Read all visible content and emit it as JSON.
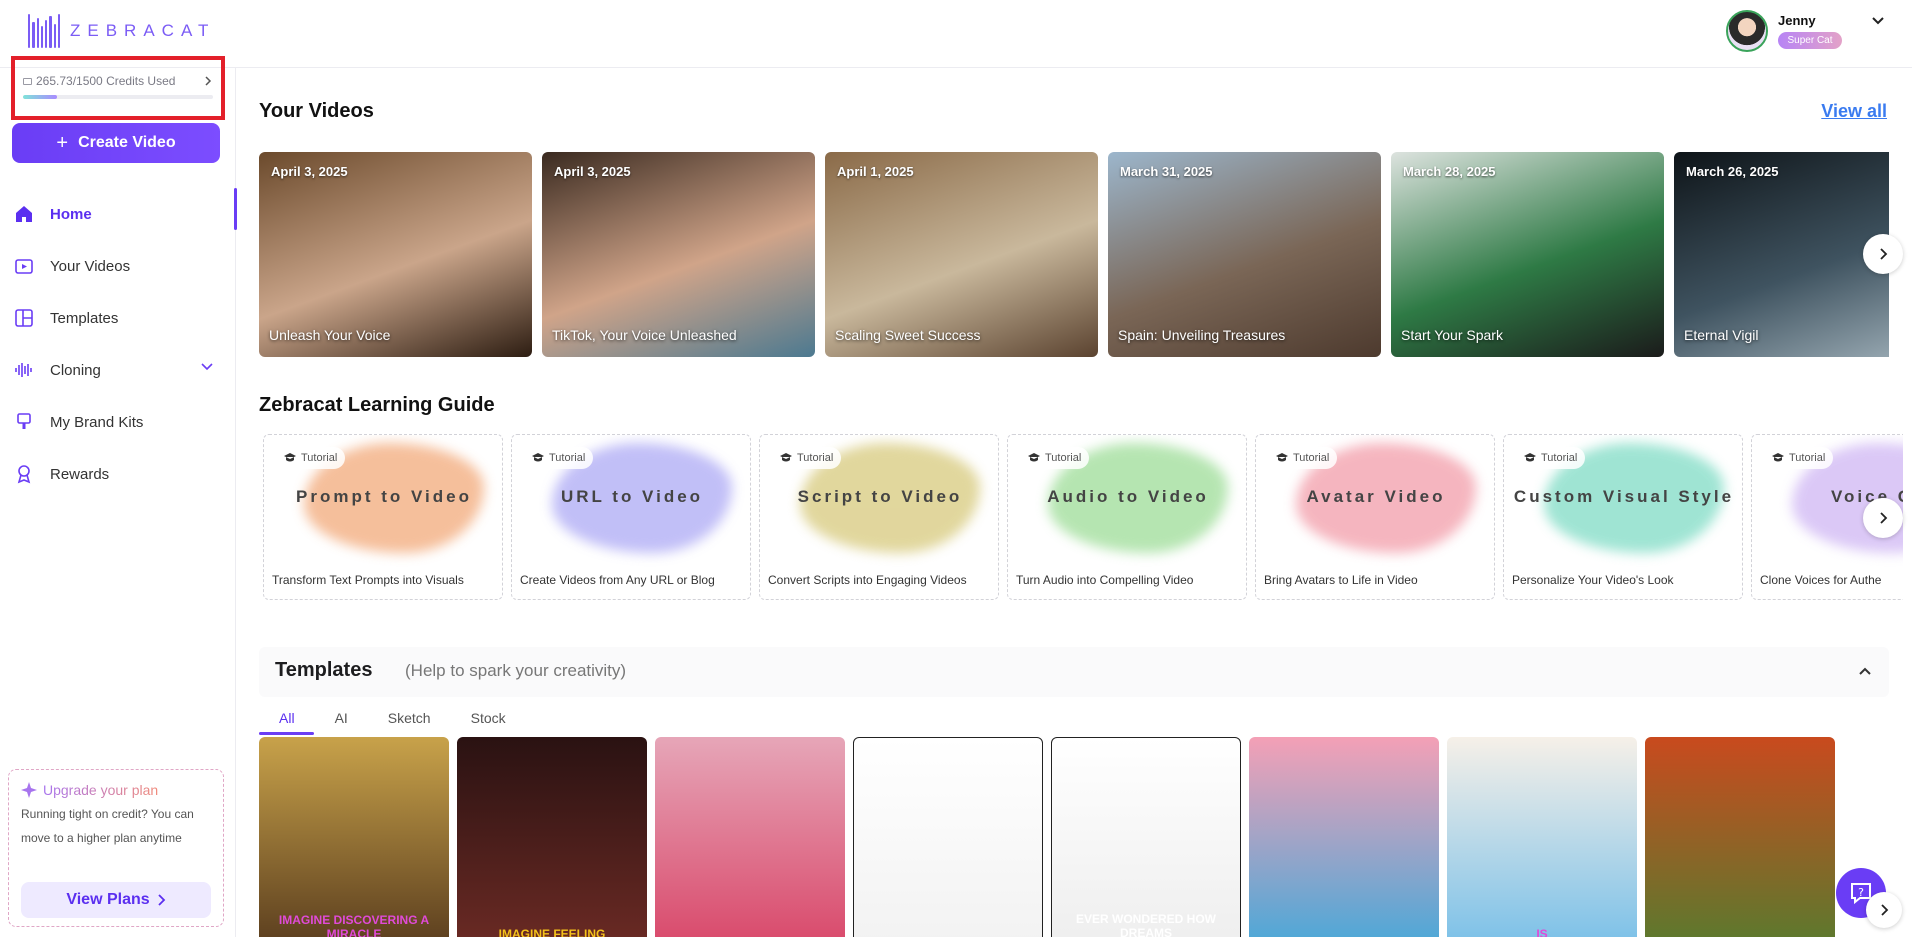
{
  "brand": {
    "name": "ZEBRACAT",
    "accent": "#6a3df5"
  },
  "user": {
    "name": "Jenny",
    "badge": "Super Cat"
  },
  "credits": {
    "label": "265.73/1500 Credits Used",
    "used": 265.73,
    "total": 1500
  },
  "create_button": "Create Video",
  "nav": [
    {
      "label": "Home",
      "icon": "home-icon",
      "active": true
    },
    {
      "label": "Your Videos",
      "icon": "play-icon"
    },
    {
      "label": "Templates",
      "icon": "layout-icon"
    },
    {
      "label": "Cloning",
      "icon": "waveform-icon",
      "expandable": true
    },
    {
      "label": "My Brand Kits",
      "icon": "brush-icon"
    },
    {
      "label": "Rewards",
      "icon": "trophy-icon"
    }
  ],
  "upgrade": {
    "title": "Upgrade your plan",
    "text": "Running tight on credit? You can move to a higher plan anytime",
    "button": "View Plans"
  },
  "your_videos": {
    "title": "Your Videos",
    "view_all": "View all",
    "items": [
      {
        "date": "April 3, 2025",
        "title": "Unleash Your Voice",
        "colors": [
          "#6b4a2c",
          "#caa58a",
          "#2d1d12"
        ]
      },
      {
        "date": "April 3, 2025",
        "title": "TikTok, Your Voice Unleashed",
        "colors": [
          "#3a2a20",
          "#d0a489",
          "#4c7990"
        ]
      },
      {
        "date": "April 1, 2025",
        "title": "Scaling Sweet Success",
        "colors": [
          "#8a6a48",
          "#c9b89c",
          "#5b4330"
        ]
      },
      {
        "date": "March 31, 2025",
        "title": "Spain: Unveiling Treasures",
        "colors": [
          "#9cb6cc",
          "#7a6656",
          "#4d3a2e"
        ]
      },
      {
        "date": "March 28, 2025",
        "title": "Start Your Spark",
        "colors": [
          "#dde3df",
          "#2e7a45",
          "#1b1b1b"
        ]
      },
      {
        "date": "March 26, 2025",
        "title": "Eternal Vigil",
        "colors": [
          "#0e1418",
          "#3f5360",
          "#a3b3bc"
        ]
      }
    ]
  },
  "learning_guide": {
    "title": "Zebracat Learning Guide",
    "pill": "Tutorial",
    "items": [
      {
        "name": "Prompt to Video",
        "desc": "Transform Text Prompts into Visuals",
        "color": "#f4b48a"
      },
      {
        "name": "URL to Video",
        "desc": "Create Videos from Any URL or Blog",
        "color": "#b7b4f6"
      },
      {
        "name": "Script to Video",
        "desc": "Convert Scripts into Engaging Videos",
        "color": "#dcd08c"
      },
      {
        "name": "Audio to Video",
        "desc": "Turn Audio into Compelling Video",
        "color": "#a9e1a4"
      },
      {
        "name": "Avatar Video",
        "desc": "Bring Avatars to Life in Video",
        "color": "#f4a9b4"
      },
      {
        "name": "Custom Visual Style",
        "desc": "Personalize Your Video's Look",
        "color": "#8fe0cc"
      },
      {
        "name": "Voice C",
        "desc": "Clone Voices for Authe",
        "color": "#d5bff5"
      }
    ]
  },
  "templates": {
    "title": "Templates",
    "subtitle": "(Help to spark your creativity)",
    "tabs": [
      "All",
      "AI",
      "Sketch",
      "Stock"
    ],
    "active_tab": "All",
    "items": [
      {
        "caption": "IMAGINE DISCOVERING A MIRACLE",
        "colors": [
          "#c8a24a",
          "#5a3d1e"
        ],
        "caption_color": "#e04ad8"
      },
      {
        "caption": "IMAGINE FEELING",
        "colors": [
          "#2a1212",
          "#6b2a24"
        ],
        "caption_color": "#f4c21a"
      },
      {
        "caption": "",
        "colors": [
          "#e6a6b8",
          "#d9486a"
        ],
        "caption_color": "#ffffff"
      },
      {
        "caption": "",
        "colors": [
          "#ffffff",
          "#f2f2f2"
        ],
        "caption_color": "#000000"
      },
      {
        "caption": "EVER WONDERED HOW DREAMS",
        "colors": [
          "#ffffff",
          "#eeeeee"
        ],
        "caption_color": "#ffffff"
      },
      {
        "caption": "",
        "colors": [
          "#f4a0b6",
          "#4aa8d8"
        ],
        "caption_color": "#ffffff"
      },
      {
        "caption": "IS",
        "colors": [
          "#f6f0e8",
          "#7ac0e8"
        ],
        "caption_color": "#e04ad8"
      },
      {
        "caption": "",
        "colors": [
          "#c94a1e",
          "#5a7a2e"
        ],
        "caption_color": "#ffffff"
      }
    ]
  }
}
